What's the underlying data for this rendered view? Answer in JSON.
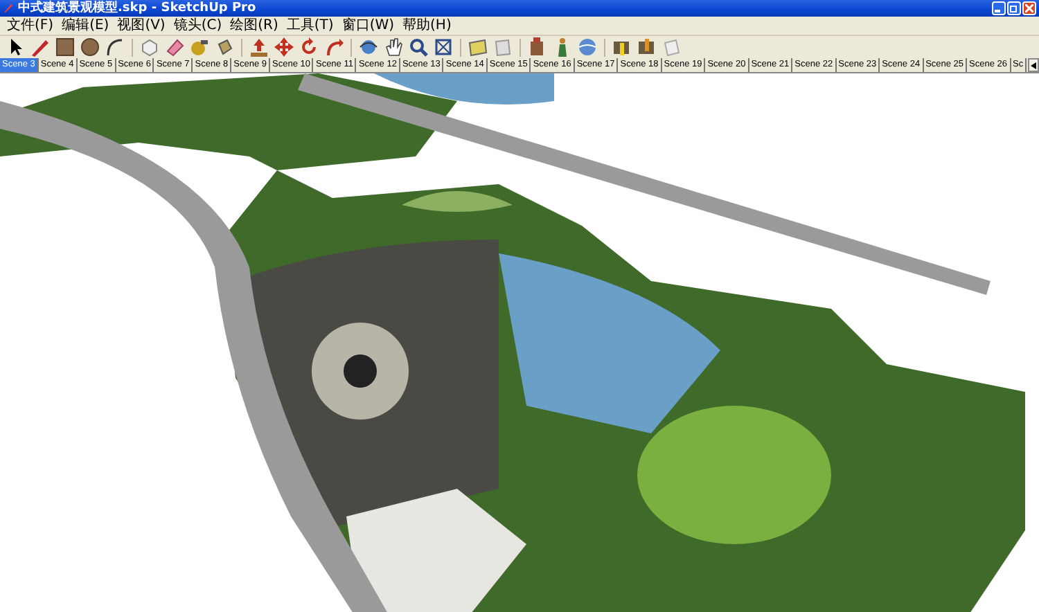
{
  "window": {
    "title": "中式建筑景观模型.skp - SketchUp Pro"
  },
  "menu": [
    "文件(F)",
    "编辑(E)",
    "视图(V)",
    "镜头(C)",
    "绘图(R)",
    "工具(T)",
    "窗口(W)",
    "帮助(H)"
  ],
  "scene_tabs": [
    {
      "label": "Scene 3",
      "selected": true
    },
    {
      "label": "Scene 4",
      "selected": false
    },
    {
      "label": "Scene 5",
      "selected": false
    },
    {
      "label": "Scene 6",
      "selected": false
    },
    {
      "label": "Scene 7",
      "selected": false
    },
    {
      "label": "Scene 8",
      "selected": false
    },
    {
      "label": "Scene 9",
      "selected": false
    },
    {
      "label": "Scene 10",
      "selected": false
    },
    {
      "label": "Scene 11",
      "selected": false
    },
    {
      "label": "Scene 12",
      "selected": false
    },
    {
      "label": "Scene 13",
      "selected": false
    },
    {
      "label": "Scene 14",
      "selected": false
    },
    {
      "label": "Scene 15",
      "selected": false
    },
    {
      "label": "Scene 16",
      "selected": false
    },
    {
      "label": "Scene 17",
      "selected": false
    },
    {
      "label": "Scene 18",
      "selected": false
    },
    {
      "label": "Scene 19",
      "selected": false
    },
    {
      "label": "Scene 20",
      "selected": false
    },
    {
      "label": "Scene 21",
      "selected": false
    },
    {
      "label": "Scene 22",
      "selected": false
    },
    {
      "label": "Scene 23",
      "selected": false
    },
    {
      "label": "Scene 24",
      "selected": false
    },
    {
      "label": "Scene 25",
      "selected": false
    },
    {
      "label": "Scene 26",
      "selected": false
    },
    {
      "label": "Sc",
      "selected": false
    }
  ]
}
